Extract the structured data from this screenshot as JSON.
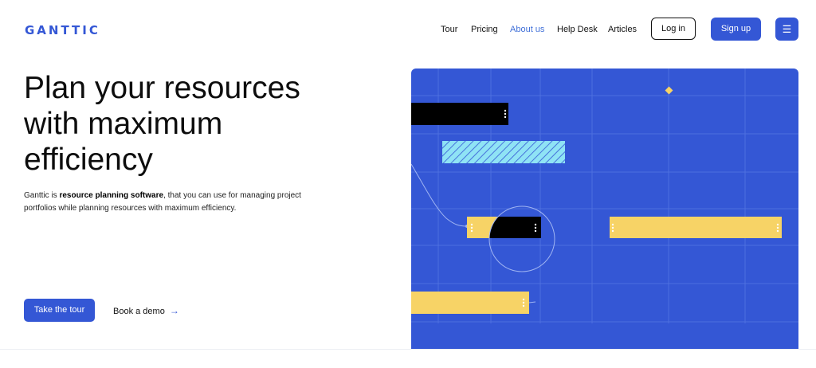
{
  "brand": {
    "name": "GANTTIC"
  },
  "nav": {
    "links": [
      "Tour",
      "Pricing",
      "About us",
      "Help Desk",
      "Articles"
    ],
    "active": "About us",
    "login_label": "Log in",
    "signup_label": "Sign up",
    "menu_icon": "hamburger-menu-icon"
  },
  "hero": {
    "title": "Plan your resources with maximum efficiency",
    "description_prefix": "Ganttic is ",
    "description_bold": "resource planning software",
    "description_suffix": ", that you can use for managing project portfolios while planning resources with maximum efficiency.",
    "cta_primary": "Take the tour",
    "cta_secondary": "Book a demo",
    "cta_secondary_icon": "arrow-right-icon"
  },
  "colors": {
    "brand_blue": "#3457d5",
    "accent_yellow": "#f7d366",
    "hatch_cyan": "#8fe3f5",
    "active_link": "#3f6fd8"
  }
}
